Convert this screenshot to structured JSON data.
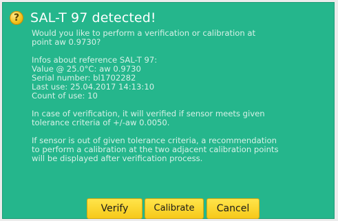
{
  "dialog": {
    "title": "SAL-T 97 detected!",
    "icon": "help-icon",
    "question": [
      "Would you like to perform a verification or calibration at",
      "point aw 0.9730?"
    ],
    "info": [
      "Infos about reference SAL-T 97:",
      "Value @ 25.0°C: aw 0.9730",
      "Serial number: bl1702282",
      "Last use: 25.04.2017 14:13:10",
      "Count of use: 10"
    ],
    "verification_note": [
      "In case of verification, it will verified if sensor meets given",
      "tolerance criteria of +/-aw 0.0050."
    ],
    "calibration_note": [
      "If sensor is out of given tolerance criteria, a recommendation",
      "to perform a calibration at the two adjacent calibration points",
      "will be displayed after verification process."
    ],
    "buttons": {
      "verify": "Verify",
      "calibrate": "Calibrate",
      "cancel": "Cancel"
    }
  },
  "colors": {
    "dialog_background": "#25b68c",
    "button_background": "#f6c91a",
    "title_text": "#ffffff"
  }
}
